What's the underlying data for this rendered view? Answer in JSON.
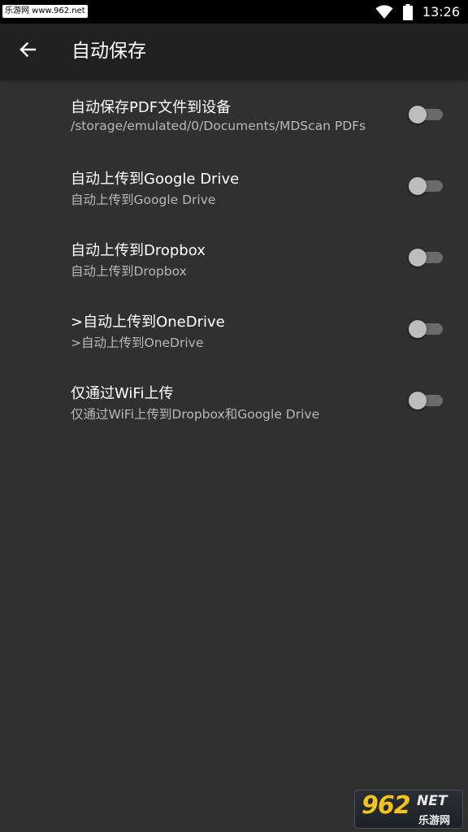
{
  "status_bar": {
    "watermark": "乐游网 www.962.net",
    "time": "13:26",
    "wifi_icon": "wifi-icon",
    "battery_icon": "battery-icon"
  },
  "toolbar": {
    "back_icon": "arrow-back-icon",
    "title": "自动保存"
  },
  "settings": [
    {
      "title": "自动保存PDF文件到设备",
      "summary": "/storage/emulated/0/Documents/MDScan PDFs",
      "enabled": false
    },
    {
      "title": "自动上传到Google Drive",
      "summary": "自动上传到Google Drive",
      "enabled": false
    },
    {
      "title": "自动上传到Dropbox",
      "summary": "自动上传到Dropbox",
      "enabled": false
    },
    {
      "title": ">自动上传到OneDrive",
      "summary": ">自动上传到OneDrive",
      "enabled": false
    },
    {
      "title": "仅通过WiFi上传",
      "summary": "仅通过WiFi上传到Dropbox和Google Drive",
      "enabled": false
    }
  ],
  "watermark_bottom": {
    "logo": "962",
    "net": "NET",
    "sub": "乐游网"
  },
  "colors": {
    "background": "#303030",
    "toolbar": "#212121",
    "switch_off_thumb": "#bdbdbd",
    "switch_off_track": "#6b6b6b"
  }
}
